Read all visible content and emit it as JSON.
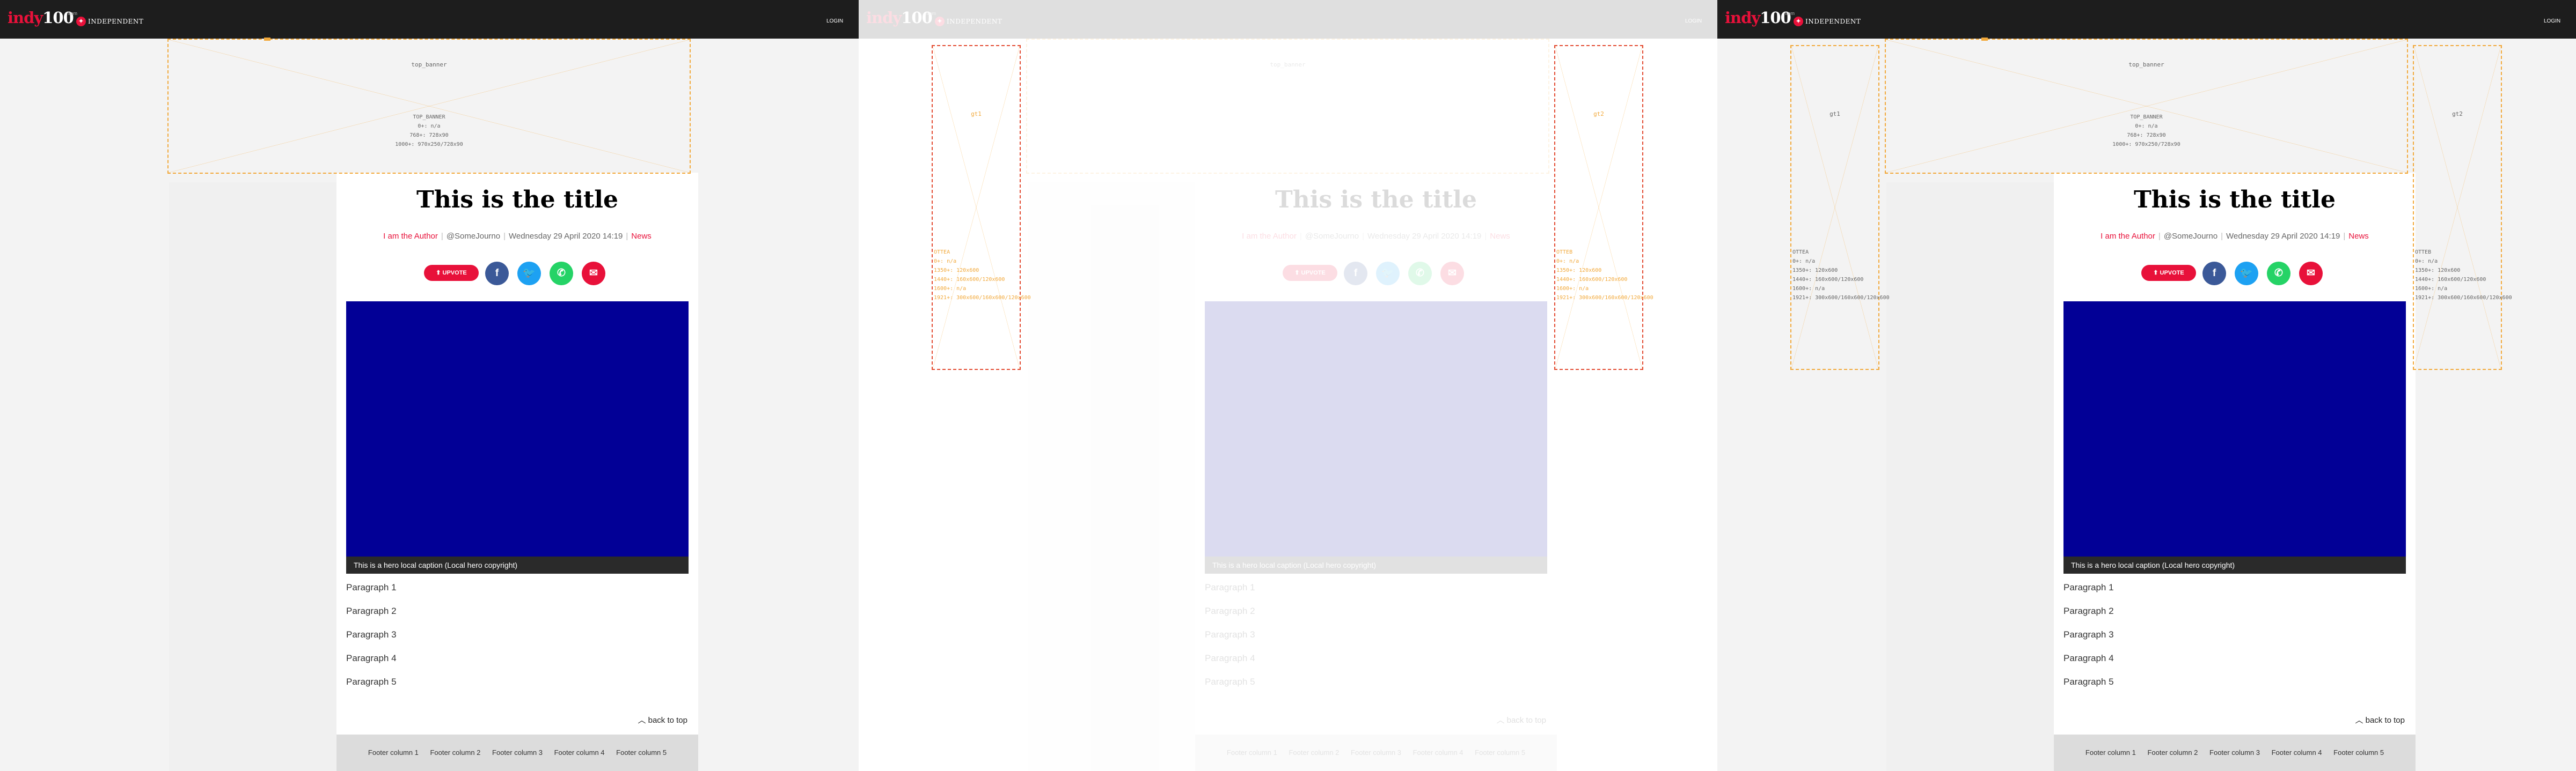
{
  "site": {
    "logo_text": "indy",
    "logo_number": "100",
    "from_label": "from",
    "partner_name": "INDEPENDENT",
    "login_label": "LOGIN"
  },
  "ads": {
    "top_banner": {
      "name": "top_banner",
      "sizes": [
        "TOP_BANNER",
        "0+: n/a",
        "768+: 728x90",
        "1000+: 970x250/728x90"
      ]
    },
    "left": {
      "name": "gt1",
      "sizes": [
        "OTTEA",
        "0+: n/a",
        "1350+: 120x600",
        "1440+: 160x600/120x600",
        "1600+: n/a",
        "1921+: 300x600/160x600/120x600"
      ]
    },
    "right": {
      "name": "gt2",
      "sizes": [
        "OTTEB",
        "0+: n/a",
        "1350+: 120x600",
        "1440+: 160x600/120x600",
        "1600+: n/a",
        "1921+: 300x600/160x600/120x600"
      ]
    }
  },
  "article": {
    "title": "This is the title",
    "author": "I am the Author",
    "handle": "@SomeJourno",
    "date": "Wednesday 29 April 2020 14:19",
    "section": "News",
    "upvote_label": "UPVOTE",
    "hero_caption": "This is a hero local caption (Local hero copyright)",
    "paragraphs": [
      "Paragraph 1",
      "Paragraph 2",
      "Paragraph 3",
      "Paragraph 4",
      "Paragraph 5"
    ],
    "back_to_top": "back to top"
  },
  "footer": {
    "columns": [
      "Footer column 1",
      "Footer column 2",
      "Footer column 3",
      "Footer column 4",
      "Footer column 5"
    ]
  },
  "colors": {
    "brand_red": "#e8113a",
    "ad_outline": "#f2a93b",
    "hero_blue": "#020096"
  },
  "icons": [
    "upvote-arrow-icon",
    "facebook-icon",
    "twitter-icon",
    "whatsapp-icon",
    "email-icon",
    "chevron-up-icon"
  ]
}
